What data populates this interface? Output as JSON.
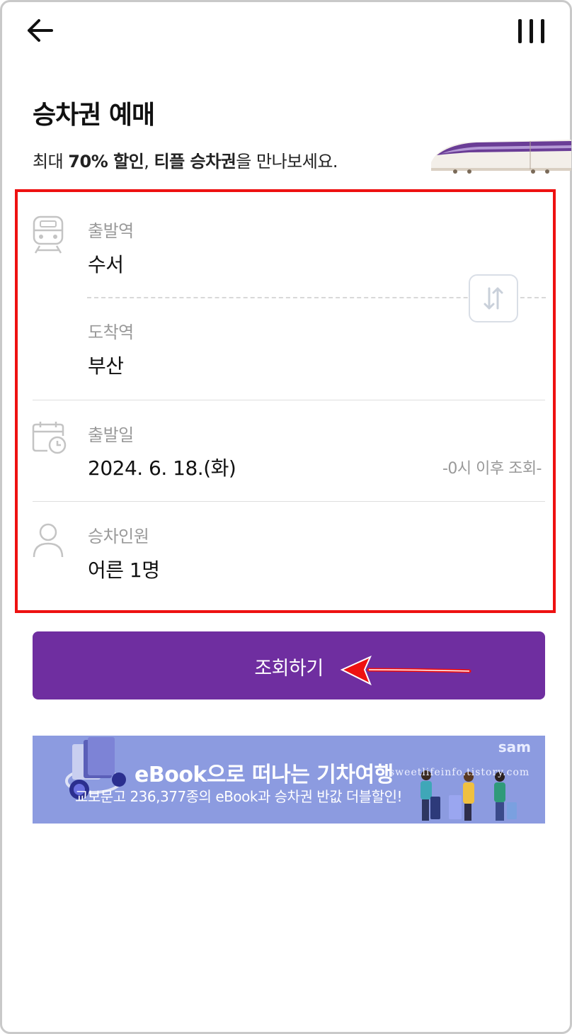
{
  "header": {
    "back_icon": "arrow-left-icon",
    "menu_icon": "three-bars-menu-icon"
  },
  "page": {
    "title": "승차권 예매",
    "subtitle_part1": "최대 ",
    "subtitle_bold1": "70% 할인",
    "subtitle_part2": ", ",
    "subtitle_bold2": "티플 승차권",
    "subtitle_part3": "을 만나보세요."
  },
  "form": {
    "departure": {
      "label": "출발역",
      "value": "수서",
      "icon": "train-icon"
    },
    "arrival": {
      "label": "도착역",
      "value": "부산"
    },
    "swap_icon": "swap-arrows-icon",
    "date": {
      "label": "출발일",
      "value": "2024. 6. 18.(화)",
      "hint": "-0시 이후 조회-",
      "icon": "calendar-clock-icon"
    },
    "passengers": {
      "label": "승차인원",
      "value": "어른 1명",
      "icon": "person-icon"
    }
  },
  "search_button": {
    "label": "조회하기"
  },
  "banner": {
    "brand": "sam",
    "title": "eBook으로 떠나는 기차여행",
    "subtitle": "교보문고 236,377종의 eBook과 승차권 반값 더블할인!",
    "watermark": "sweetlifeinfo.tistory.com"
  },
  "colors": {
    "accent_purple": "#6f2ea0",
    "highlight_red": "#ee1111",
    "banner_blue": "#8c9be0"
  }
}
